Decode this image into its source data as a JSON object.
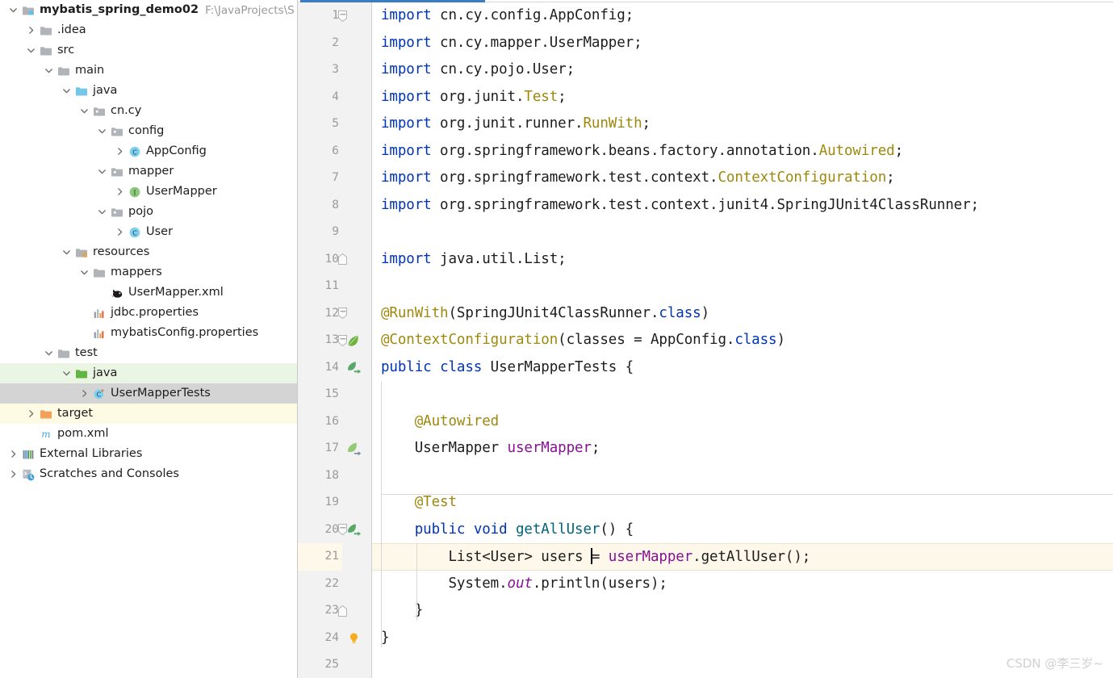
{
  "project": {
    "name": "mybatis_spring_demo02",
    "path_hint": "F:\\JavaProjects\\S",
    "tree": [
      {
        "label": "mybatis_spring_demo02",
        "icon": "module-folder-icon",
        "arrow": "down",
        "depth": 0,
        "bold": true,
        "highlight": "none",
        "path_hint": "F:\\JavaProjects\\S"
      },
      {
        "label": ".idea",
        "icon": "folder-icon",
        "arrow": "right",
        "depth": 1,
        "bold": false,
        "highlight": "none"
      },
      {
        "label": "src",
        "icon": "folder-icon",
        "arrow": "down",
        "depth": 1,
        "bold": false,
        "highlight": "none"
      },
      {
        "label": "main",
        "icon": "folder-icon",
        "arrow": "down",
        "depth": 2,
        "bold": false,
        "highlight": "none"
      },
      {
        "label": "java",
        "icon": "source-root-icon",
        "arrow": "down",
        "depth": 3,
        "bold": false,
        "highlight": "none"
      },
      {
        "label": "cn.cy",
        "icon": "package-icon",
        "arrow": "down",
        "depth": 4,
        "bold": false,
        "highlight": "none"
      },
      {
        "label": "config",
        "icon": "package-icon",
        "arrow": "down",
        "depth": 5,
        "bold": false,
        "highlight": "none"
      },
      {
        "label": "AppConfig",
        "icon": "java-class-icon",
        "arrow": "right",
        "depth": 6,
        "bold": false,
        "highlight": "none"
      },
      {
        "label": "mapper",
        "icon": "package-icon",
        "arrow": "down",
        "depth": 5,
        "bold": false,
        "highlight": "none"
      },
      {
        "label": "UserMapper",
        "icon": "java-interface-icon",
        "arrow": "right",
        "depth": 6,
        "bold": false,
        "highlight": "none"
      },
      {
        "label": "pojo",
        "icon": "package-icon",
        "arrow": "down",
        "depth": 5,
        "bold": false,
        "highlight": "none"
      },
      {
        "label": "User",
        "icon": "java-class-icon",
        "arrow": "right",
        "depth": 6,
        "bold": false,
        "highlight": "none"
      },
      {
        "label": "resources",
        "icon": "resource-root-icon",
        "arrow": "down",
        "depth": 3,
        "bold": false,
        "highlight": "none"
      },
      {
        "label": "mappers",
        "icon": "folder-icon",
        "arrow": "down",
        "depth": 4,
        "bold": false,
        "highlight": "none"
      },
      {
        "label": "UserMapper.xml",
        "icon": "mybatis-xml-icon",
        "arrow": "none",
        "depth": 5,
        "bold": false,
        "highlight": "none"
      },
      {
        "label": "jdbc.properties",
        "icon": "properties-icon",
        "arrow": "none",
        "depth": 4,
        "bold": false,
        "highlight": "none"
      },
      {
        "label": "mybatisConfig.properties",
        "icon": "properties-icon",
        "arrow": "none",
        "depth": 4,
        "bold": false,
        "highlight": "none"
      },
      {
        "label": "test",
        "icon": "folder-icon",
        "arrow": "down",
        "depth": 2,
        "bold": false,
        "highlight": "none"
      },
      {
        "label": "java",
        "icon": "test-source-root-icon",
        "arrow": "down",
        "depth": 3,
        "bold": false,
        "highlight": "green"
      },
      {
        "label": "UserMapperTests",
        "icon": "java-test-class-icon",
        "arrow": "right",
        "depth": 4,
        "bold": false,
        "highlight": "gray"
      },
      {
        "label": "target",
        "icon": "excluded-folder-icon",
        "arrow": "right",
        "depth": 1,
        "bold": false,
        "highlight": "cream"
      },
      {
        "label": "pom.xml",
        "icon": "maven-icon",
        "arrow": "none",
        "depth": 1,
        "bold": false,
        "highlight": "none"
      },
      {
        "label": "External Libraries",
        "icon": "libraries-icon",
        "arrow": "right",
        "depth": 0,
        "bold": false,
        "highlight": "none"
      },
      {
        "label": "Scratches and Consoles",
        "icon": "scratches-icon",
        "arrow": "right",
        "depth": 0,
        "bold": false,
        "highlight": "none"
      }
    ]
  },
  "editor": {
    "accent_color": "#3b7dc4",
    "current_line": 21,
    "total_visible_lines": 25,
    "lines": [
      {
        "n": 1,
        "gutter_icon": "none",
        "fold": "fold-collapse-top",
        "text": "import cn.cy.config.AppConfig;"
      },
      {
        "n": 2,
        "gutter_icon": "none",
        "fold": "none",
        "text": "import cn.cy.mapper.UserMapper;"
      },
      {
        "n": 3,
        "gutter_icon": "none",
        "fold": "none",
        "text": "import cn.cy.pojo.User;"
      },
      {
        "n": 4,
        "gutter_icon": "none",
        "fold": "none",
        "text": "import org.junit.Test;"
      },
      {
        "n": 5,
        "gutter_icon": "none",
        "fold": "none",
        "text": "import org.junit.runner.RunWith;"
      },
      {
        "n": 6,
        "gutter_icon": "none",
        "fold": "none",
        "text": "import org.springframework.beans.factory.annotation.Autowired;"
      },
      {
        "n": 7,
        "gutter_icon": "none",
        "fold": "none",
        "text": "import org.springframework.test.context.ContextConfiguration;"
      },
      {
        "n": 8,
        "gutter_icon": "none",
        "fold": "none",
        "text": "import org.springframework.test.context.junit4.SpringJUnit4ClassRunner;"
      },
      {
        "n": 9,
        "gutter_icon": "none",
        "fold": "none",
        "text": ""
      },
      {
        "n": 10,
        "gutter_icon": "none",
        "fold": "fold-collapse-bottom",
        "text": "import java.util.List;"
      },
      {
        "n": 11,
        "gutter_icon": "none",
        "fold": "none",
        "text": ""
      },
      {
        "n": 12,
        "gutter_icon": "none",
        "fold": "fold-collapse-top",
        "text": "@RunWith(SpringJUnit4ClassRunner.class)"
      },
      {
        "n": 13,
        "gutter_icon": "spring-leaf-icon",
        "fold": "fold-collapse-top",
        "text": "@ContextConfiguration(classes = AppConfig.class)"
      },
      {
        "n": 14,
        "gutter_icon": "run-test-icon",
        "fold": "none",
        "text": "public class UserMapperTests {"
      },
      {
        "n": 15,
        "gutter_icon": "none",
        "fold": "none",
        "text": ""
      },
      {
        "n": 16,
        "gutter_icon": "none",
        "fold": "none",
        "text": "    @Autowired"
      },
      {
        "n": 17,
        "gutter_icon": "spring-bean-icon",
        "fold": "none",
        "text": "    UserMapper userMapper;"
      },
      {
        "n": 18,
        "gutter_icon": "none",
        "fold": "none",
        "text": ""
      },
      {
        "n": 19,
        "gutter_icon": "none",
        "fold": "none",
        "text": "    @Test"
      },
      {
        "n": 20,
        "gutter_icon": "run-test-icon",
        "fold": "fold-collapse-top",
        "text": "    public void getAllUser() {"
      },
      {
        "n": 21,
        "gutter_icon": "none",
        "fold": "none",
        "text": "        List<User> users = userMapper.getAllUser();"
      },
      {
        "n": 22,
        "gutter_icon": "none",
        "fold": "none",
        "text": "        System.out.println(users);"
      },
      {
        "n": 23,
        "gutter_icon": "none",
        "fold": "fold-collapse-bottom",
        "text": "    }"
      },
      {
        "n": 24,
        "gutter_icon": "lightbulb-icon",
        "fold": "none",
        "text": "}"
      },
      {
        "n": 25,
        "gutter_icon": "none",
        "fold": "none",
        "text": ""
      }
    ]
  },
  "watermark": {
    "text": "CSDN @李三岁~"
  }
}
